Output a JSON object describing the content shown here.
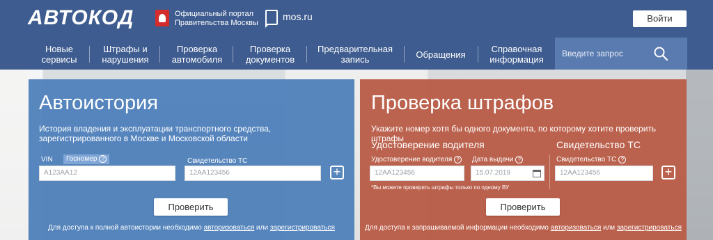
{
  "header": {
    "logo": "АВТОКОД",
    "portal_text": "Официальный портал Правительства Москвы",
    "mos_link": "mos.ru",
    "login_label": "Войти"
  },
  "nav": {
    "items": [
      {
        "label": "Новые сервисы"
      },
      {
        "label": "Штрафы и нарушения"
      },
      {
        "label": "Проверка автомобиля"
      },
      {
        "label": "Проверка документов"
      },
      {
        "label": "Предварительная запись"
      },
      {
        "label": "Обращения"
      },
      {
        "label": "Справочная информация"
      }
    ],
    "search_placeholder": "Введите запрос"
  },
  "autohistory": {
    "title": "Автоистория",
    "description": "История владения и эксплуатации транспортного средства, зарегистрированного в Москве и Московской области",
    "vin_label": "VIN",
    "gosnomer_tag": "Госномер",
    "plate_value": "А123АА12",
    "cert_label": "Свидетельство ТС",
    "cert_value": "12АА123456",
    "check_label": "Проверить",
    "footer_prefix": "Для доступа к полной автоистории необходимо",
    "footer_link1": "авторизоваться",
    "footer_or": "или",
    "footer_link2": "зарегистрироваться"
  },
  "fines": {
    "title": "Проверка штрафов",
    "description": "Укажите номер хотя бы одного документа, по которому хотите проверить штрафы",
    "driver_heading": "Удостоверение водителя",
    "cert_heading": "Свидетельство ТС",
    "license_label": "Удостоверение водителя",
    "license_value": "12АА123456",
    "date_label": "Дата выдачи",
    "date_value": "15.07.2019",
    "cert_label": "Свидетельство ТС",
    "cert_value": "12АА123456",
    "note": "*Вы можете проверить штрафы только по одному ВУ",
    "check_label": "Проверить",
    "footer_prefix": "Для доступа к запрашиваемой информации необходимо",
    "footer_link1": "авторизоваться",
    "footer_or": "или",
    "footer_link2": "зарегистрироваться"
  },
  "colors": {
    "header": "#3e5c8f",
    "autohistory_panel": "#4f81bb",
    "fines_panel": "#b95d48"
  }
}
